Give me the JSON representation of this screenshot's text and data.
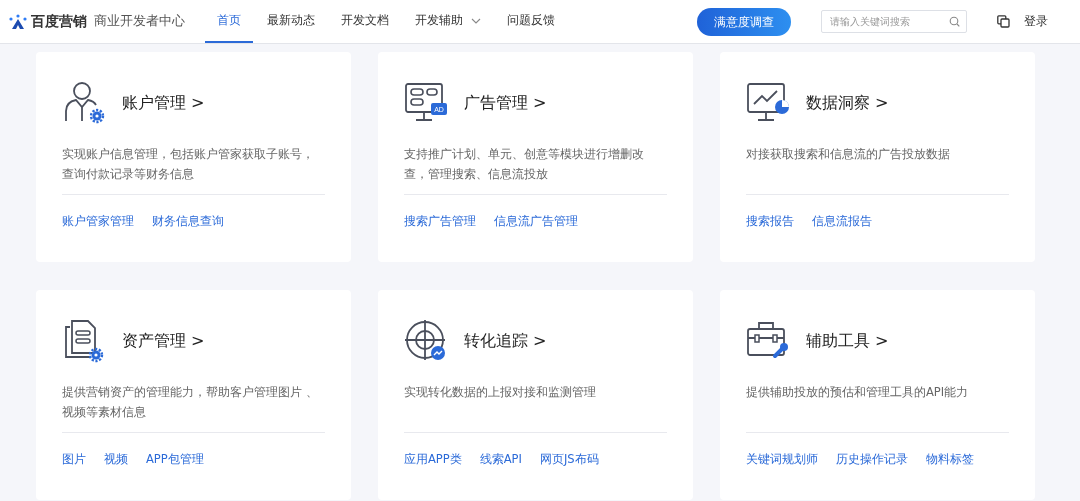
{
  "header": {
    "brand": "百度营销",
    "subtitle": "商业开发者中心",
    "nav": [
      {
        "label": "首页",
        "selected": true,
        "dropdown": false
      },
      {
        "label": "最新动态",
        "selected": false,
        "dropdown": false
      },
      {
        "label": "开发文档",
        "selected": false,
        "dropdown": false
      },
      {
        "label": "开发辅助",
        "selected": false,
        "dropdown": true
      },
      {
        "label": "问题反馈",
        "selected": false,
        "dropdown": false
      }
    ],
    "survey_button": "满意度调查",
    "search": {
      "placeholder": "请输入关键词搜索"
    },
    "login": "登录"
  },
  "cards": [
    {
      "title": "账户管理 >",
      "description": "实现账户信息管理，包括账户管家获取子账号，查询付款记录等财务信息",
      "links": [
        "账户管家管理",
        "财务信息查询"
      ]
    },
    {
      "title": "广告管理 >",
      "icon_badge": "AD",
      "description": "支持推广计划、单元、创意等模块进行增删改查，管理搜索、信息流投放",
      "links": [
        "搜索广告管理",
        "信息流广告管理"
      ]
    },
    {
      "title": "数据洞察 >",
      "description": "对接获取搜索和信息流的广告投放数据",
      "links": [
        "搜索报告",
        "信息流报告"
      ]
    },
    {
      "title": "资产管理 >",
      "description": "提供营销资产的管理能力，帮助客户管理图片 、视频等素材信息",
      "links": [
        "图片",
        "视频",
        "APP包管理"
      ]
    },
    {
      "title": "转化追踪 >",
      "description": "实现转化数据的上报对接和监测管理",
      "links": [
        "应用APP类",
        "线索API",
        "网页JS布码"
      ]
    },
    {
      "title": "辅助工具 >",
      "description": "提供辅助投放的预估和管理工具的API能力",
      "links": [
        "关键词规划师",
        "历史操作记录",
        "物料标签"
      ]
    }
  ]
}
